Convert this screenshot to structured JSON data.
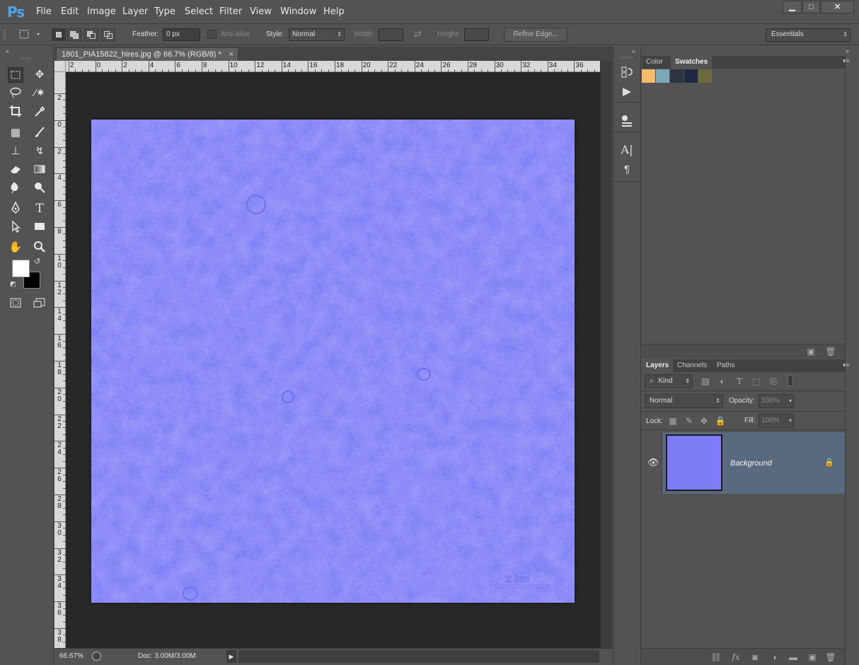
{
  "app": {
    "logo": "Ps"
  },
  "menu": [
    "File",
    "Edit",
    "Image",
    "Layer",
    "Type",
    "Select",
    "Filter",
    "View",
    "Window",
    "Help"
  ],
  "window_controls": {
    "minimize": "▁",
    "maximize": "□",
    "close": "✕"
  },
  "options": {
    "feather_label": "Feather:",
    "feather_value": "0 px",
    "antialias_label": "Anti-alias",
    "style_label": "Style:",
    "style_value": "Normal",
    "width_label": "Width:",
    "height_label": "Height:",
    "refine_edge": "Refine Edge...",
    "workspace": "Essentials"
  },
  "document": {
    "tab_title": "1801_PIA15822_hires.jpg @ 66.7% (RGB/8) *",
    "close": "×",
    "scale_bar_label": "2 km",
    "canvas_color": "#7d7cf6"
  },
  "ruler_h": [
    "2",
    "0",
    "2",
    "4",
    "6",
    "8",
    "10",
    "12",
    "14",
    "16",
    "18",
    "20",
    "22",
    "24",
    "26",
    "28",
    "30",
    "32",
    "34",
    "36"
  ],
  "ruler_v": [
    "2",
    "0",
    "2",
    "4",
    "6",
    "8",
    "10",
    "12",
    "14",
    "16",
    "18",
    "20",
    "22",
    "24",
    "26",
    "28",
    "30",
    "32",
    "34",
    "36",
    "38"
  ],
  "status": {
    "zoom": "66.67%",
    "doc": "Doc: 3.00M/3.00M",
    "arrow": "▶"
  },
  "color_panel": {
    "tabs": [
      "Color",
      "Swatches"
    ],
    "active_tab": "Swatches",
    "swatches": [
      "#f3bb6a",
      "#7ba9b3",
      "#2e3440",
      "#1e2a44",
      "#6b6a3c"
    ]
  },
  "layers_panel": {
    "tabs": [
      "Layers",
      "Channels",
      "Paths"
    ],
    "active_tab": "Layers",
    "kind_label": "Kind",
    "blend_mode": "Normal",
    "opacity_label": "Opacity:",
    "opacity_value": "100%",
    "lock_label": "Lock:",
    "fill_label": "Fill:",
    "fill_value": "100%",
    "layer_name": "Background"
  },
  "colors": {
    "foreground": "#ffffff",
    "background": "#000000",
    "selected_layer": "#5a6a7e"
  }
}
